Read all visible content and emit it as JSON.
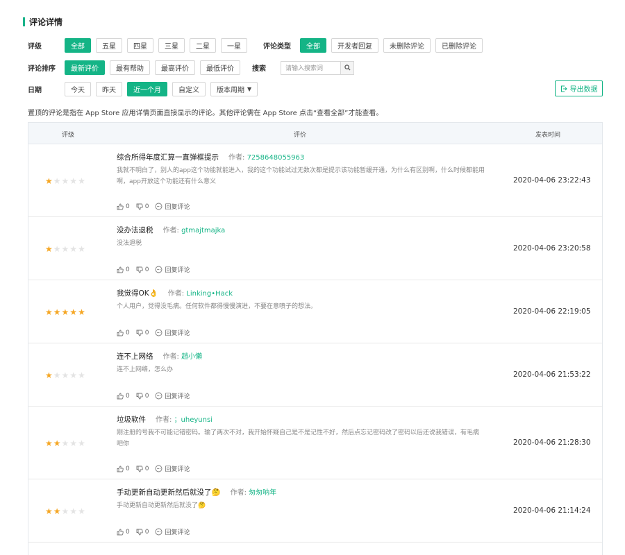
{
  "page": {
    "section_title": "评论详情",
    "note": "置顶的评论是指在 App Store 应用详情页面直接显示的评论。其他评论需在 App Store 点击“查看全部”才能查看。"
  },
  "filters": {
    "rating_label": "评级",
    "rating_options": [
      "全部",
      "五星",
      "四星",
      "三星",
      "二星",
      "一星"
    ],
    "type_label": "评论类型",
    "type_options": [
      "全部",
      "开发者回复",
      "未删除评论",
      "已删除评论"
    ],
    "sort_label": "评论排序",
    "sort_options": [
      "最新评价",
      "最有帮助",
      "最高评价",
      "最低评价"
    ],
    "search_label": "搜索",
    "search_placeholder": "请输入搜索词",
    "date_label": "日期",
    "date_options": [
      "今天",
      "昨天",
      "近一个月",
      "自定义"
    ],
    "period_dropdown": "版本周期",
    "export_label": "导出数据"
  },
  "table": {
    "headers": {
      "rating": "评级",
      "review": "评价",
      "date": "发表时间"
    },
    "author_prefix": "作者:",
    "rows": [
      {
        "stars": 1,
        "title": "综合所得年度汇算一直弹框提示",
        "author": "7258648055963",
        "body": "我就不明白了，别人的app这个功能就能进入，我的这个功能试过无数次都是提示该功能暂缓开通，为什么有区别啊，什么时候都能用啊，app开放这个功能还有什么意义",
        "likes": "0",
        "dislikes": "0",
        "reply": "回复评论",
        "date": "2020-04-06 23:22:43"
      },
      {
        "stars": 1,
        "title": "没办法退税",
        "author": "gtmajtmajka",
        "body": "没法退税",
        "likes": "0",
        "dislikes": "0",
        "reply": "回复评论",
        "date": "2020-04-06 23:20:58"
      },
      {
        "stars": 5,
        "title": "我觉得OK👌",
        "author": "Linking•Hack",
        "body": "个人用户，觉得没毛病。任何软件都得慢慢演进，不要在意喷子的想法。",
        "likes": "0",
        "dislikes": "0",
        "reply": "回复评论",
        "date": "2020-04-06 22:19:05"
      },
      {
        "stars": 1,
        "title": "连不上网络",
        "author": "趙小懶",
        "body": "连不上网络，怎么办",
        "likes": "0",
        "dislikes": "0",
        "reply": "回复评论",
        "date": "2020-04-06 21:53:22"
      },
      {
        "stars": 2,
        "title": "垃圾软件",
        "author": "；uheyunsi",
        "body": "刚注册的号我不可能记错密码。输了两次不对，我开始怀疑自己是不是记性不好，然后点忘记密码改了密码以后还说我错误，有毛病吧你",
        "likes": "0",
        "dislikes": "0",
        "reply": "回复评论",
        "date": "2020-04-06 21:28:30"
      },
      {
        "stars": 2,
        "title": "手动更新自动更新然后就没了🤔",
        "author": "匆匆呐年",
        "body": "手动更新自动更新然后就没了🤔",
        "likes": "0",
        "dislikes": "0",
        "reply": "回复评论",
        "date": "2020-04-06 21:14:24"
      }
    ]
  },
  "colors": {
    "accent": "#14b486",
    "star": "#f5a623",
    "star_off": "#e3e3e3"
  }
}
